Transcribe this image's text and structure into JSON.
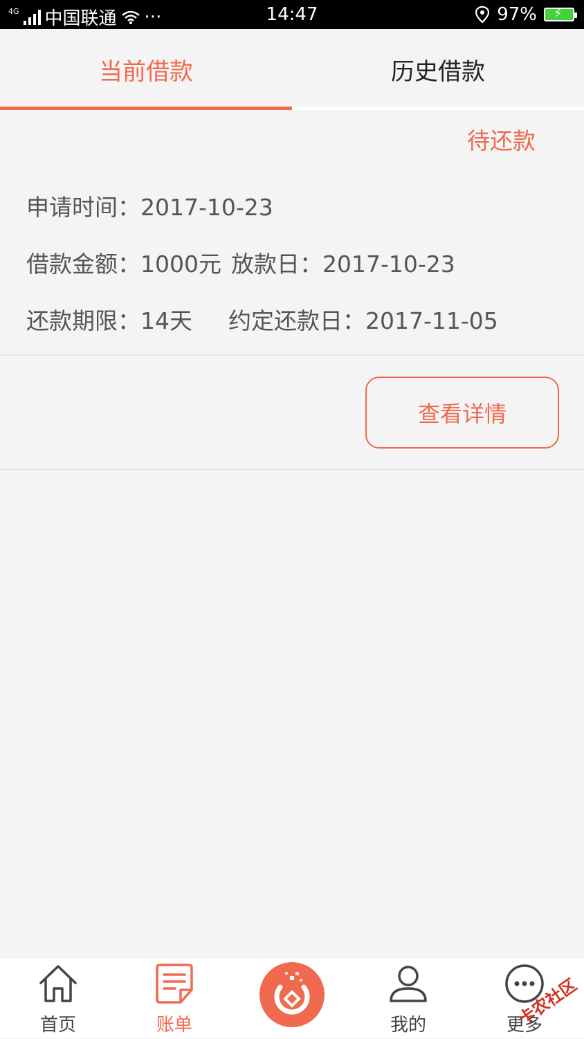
{
  "status_bar": {
    "network": "4G",
    "carrier": "中国联通",
    "dots": "···",
    "time": "14:47",
    "battery": "97%"
  },
  "tabs": [
    {
      "label": "当前借款",
      "active": true
    },
    {
      "label": "历史借款",
      "active": false
    }
  ],
  "loan": {
    "status": "待还款",
    "apply_time_label": "申请时间：",
    "apply_time": "2017-10-23",
    "amount_label": "借款金额：",
    "amount": "1000元",
    "release_label": "放款日：",
    "release_date": "2017-10-23",
    "term_label": "还款期限：",
    "term": "14天",
    "due_label": "约定还款日：",
    "due_date": "2017-11-05",
    "detail_button": "查看详情"
  },
  "bottom_nav": [
    {
      "label": "首页",
      "icon": "home-icon"
    },
    {
      "label": "账单",
      "icon": "bill-icon",
      "active": true
    },
    {
      "label": "",
      "icon": "center-money-icon"
    },
    {
      "label": "我的",
      "icon": "user-icon"
    },
    {
      "label": "更多",
      "icon": "more-icon"
    }
  ],
  "watermark": "卡农社区",
  "colors": {
    "accent": "#f06a50",
    "background": "#f4f4f4",
    "battery": "#43d13c"
  }
}
